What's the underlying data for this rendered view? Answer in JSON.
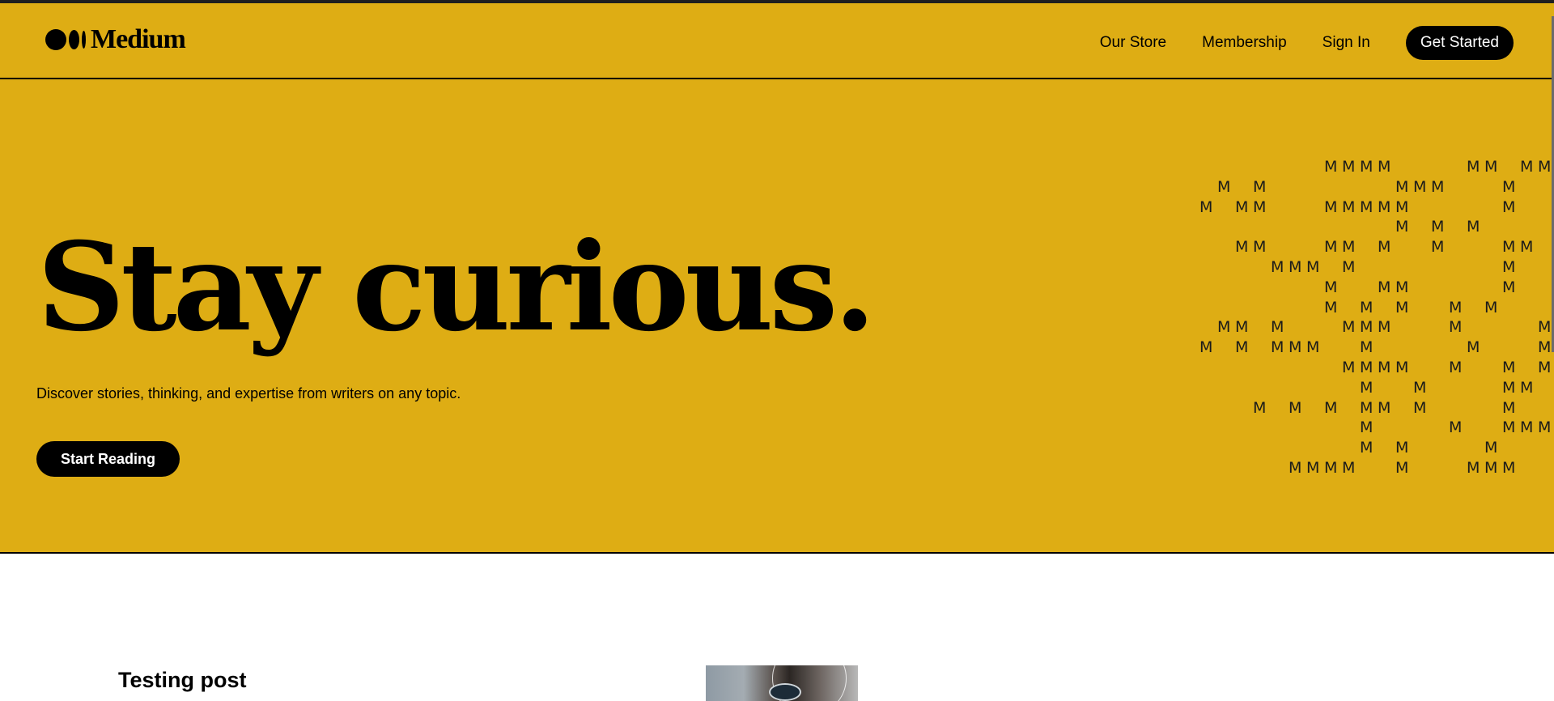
{
  "brand": {
    "name": "Medium"
  },
  "nav": {
    "links": [
      "Our Store",
      "Membership",
      "Sign In"
    ],
    "cta": "Get Started"
  },
  "hero": {
    "title": "Stay curious.",
    "subtitle": "Discover stories, thinking, and expertise from writers on any topic.",
    "button": "Start Reading",
    "background": "#dead14",
    "pattern_letter": "M"
  },
  "feed": {
    "posts": [
      {
        "title": "Testing post"
      }
    ]
  },
  "colors": {
    "accent": "#dead14",
    "text": "#000000",
    "button_text": "#ffffff"
  }
}
